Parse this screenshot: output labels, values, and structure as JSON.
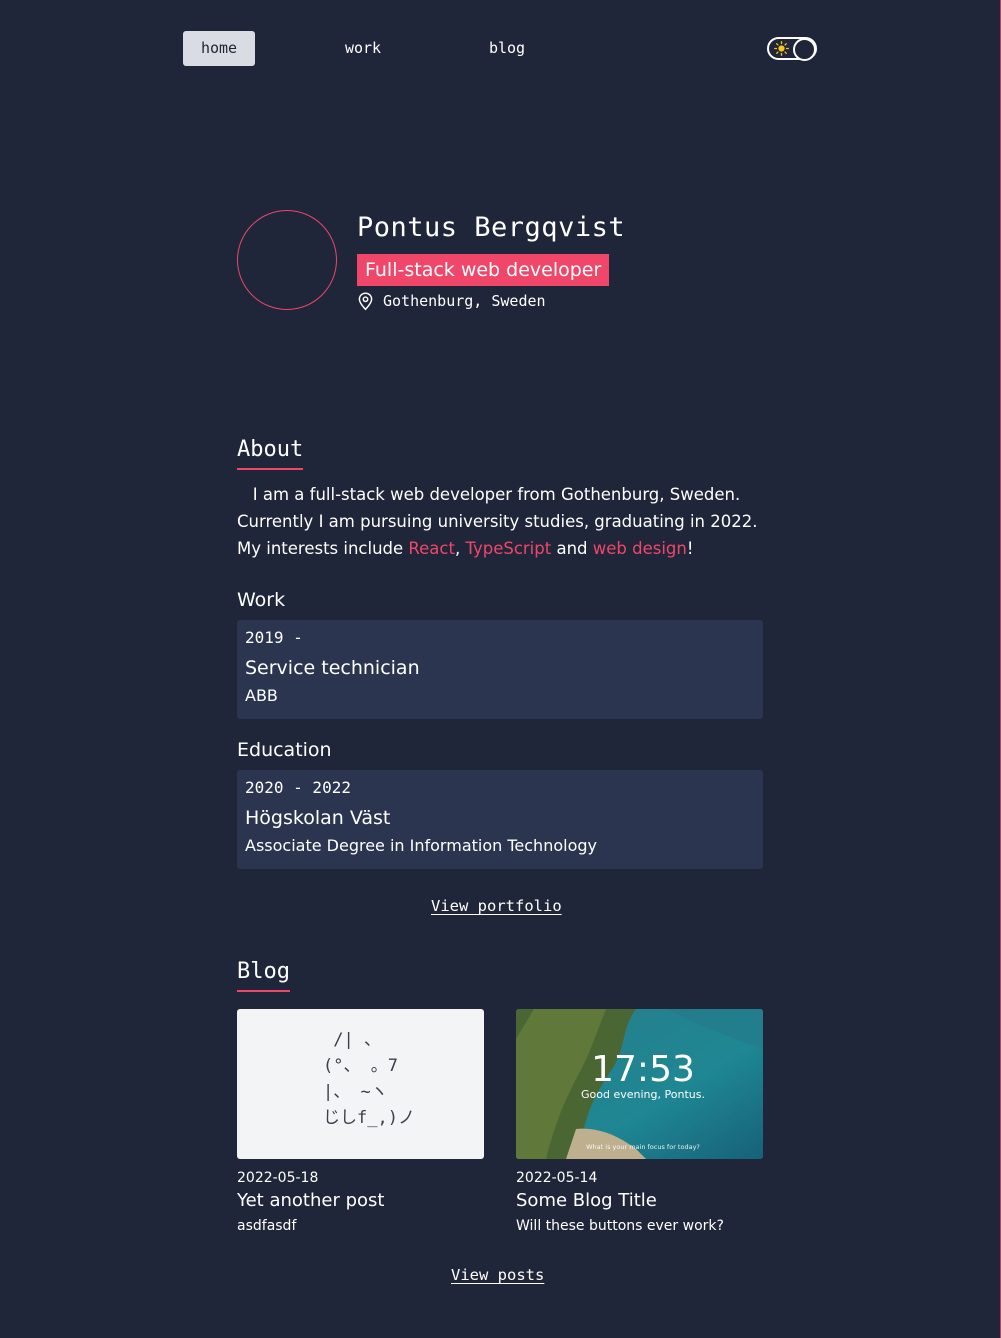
{
  "nav": {
    "home": "home",
    "work": "work",
    "blog": "blog"
  },
  "profile": {
    "name": "Pontus Bergqvist",
    "role": "Full-stack web developer",
    "location": "Gothenburg, Sweden"
  },
  "about": {
    "title": "About",
    "line1": "I am a full-stack web developer from Gothenburg, Sweden.",
    "line2": "Currently I am pursuing university studies, graduating in 2022.",
    "line3_prefix": "My interests include ",
    "interest1": "React",
    "sep1": ", ",
    "interest2": "TypeScript",
    "sep2": " and ",
    "interest3": "web design",
    "suffix": "!"
  },
  "work": {
    "title": "Work",
    "years": "2019 -",
    "position": "Service technician",
    "company": "ABB"
  },
  "education": {
    "title": "Education",
    "years": "2020 - 2022",
    "school": "Högskolan Väst",
    "degree": "Associate Degree in Information Technology"
  },
  "view_portfolio": "View portfolio",
  "blog": {
    "title": "Blog",
    "posts": [
      {
        "date": "2022-05-18",
        "title": "Yet another post",
        "description": "asdfasdf",
        "thumb_ascii": " /| 、\n(°、 。7\n|、 ~ヽ\nじしf_,)ノ"
      },
      {
        "date": "2022-05-14",
        "title": "Some Blog Title",
        "description": "Will these buttons ever work?",
        "thumb_clock": "17:53",
        "thumb_greeting": "Good evening, Pontus.",
        "thumb_focus": "What is your main focus for today?"
      }
    ],
    "view_posts": "View posts"
  },
  "colors": {
    "background": "#202639",
    "card": "#2b3550",
    "accent": "#f0466a"
  }
}
